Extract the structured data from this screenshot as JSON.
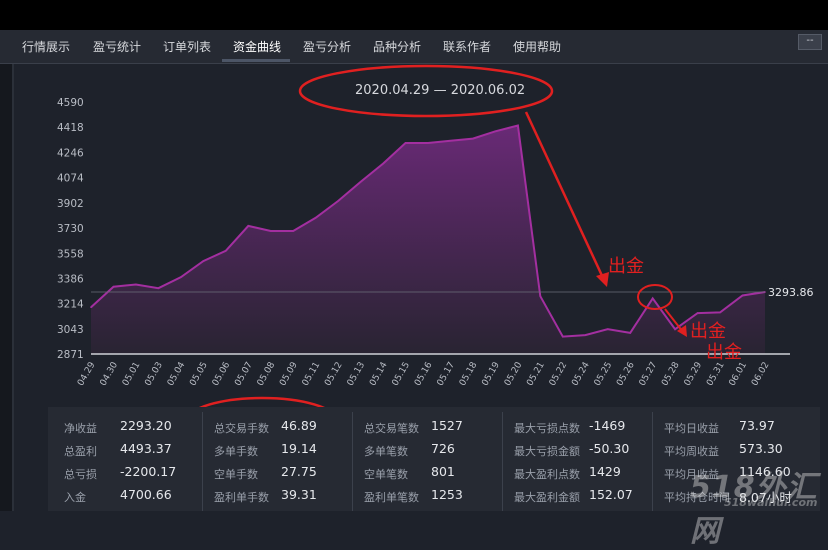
{
  "tabs": [
    {
      "label": "行情展示"
    },
    {
      "label": "盈亏统计"
    },
    {
      "label": "订单列表"
    },
    {
      "label": "资金曲线"
    },
    {
      "label": "盈亏分析"
    },
    {
      "label": "品种分析"
    },
    {
      "label": "联系作者"
    },
    {
      "label": "使用帮助"
    }
  ],
  "window": {
    "minimize_label": "--"
  },
  "chart_title": "2020.04.29 — 2020.06.02",
  "annotations": {
    "withdraw_1": "出金",
    "withdraw_2": "出金",
    "withdraw_3": "出金"
  },
  "colors": {
    "line": "#a32fa0",
    "fill_top": "#6d2a7a",
    "annotation": "#e02020"
  },
  "chart_data": {
    "type": "area",
    "x": [
      "04.29",
      "04.30",
      "05.01",
      "05.03",
      "05.04",
      "05.05",
      "05.06",
      "05.07",
      "05.08",
      "05.09",
      "05.11",
      "05.12",
      "05.13",
      "05.14",
      "05.15",
      "05.16",
      "05.17",
      "05.18",
      "05.19",
      "05.20",
      "05.21",
      "05.22",
      "05.24",
      "05.25",
      "05.26",
      "05.27",
      "05.28",
      "05.29",
      "05.31",
      "06.01",
      "06.02"
    ],
    "y": [
      3190,
      3330,
      3345,
      3320,
      3395,
      3505,
      3575,
      3745,
      3710,
      3710,
      3800,
      3915,
      4045,
      4170,
      4310,
      4310,
      4325,
      4340,
      4390,
      4430,
      3265,
      2990,
      3000,
      3040,
      3015,
      3250,
      3040,
      3150,
      3155,
      3270,
      3293.86
    ],
    "yticks": [
      2871,
      3043,
      3214,
      3386,
      3558,
      3730,
      3902,
      4074,
      4246,
      4418,
      4590
    ],
    "ylim": [
      2871,
      4590
    ],
    "last_value_label": "3293.86",
    "grid": false
  },
  "stats": [
    [
      {
        "label": "净收益",
        "value": "2293.20"
      },
      {
        "label": "总盈利",
        "value": "4493.37"
      },
      {
        "label": "总亏损",
        "value": "-2200.17"
      },
      {
        "label": "入金",
        "value": "4700.66"
      }
    ],
    [
      {
        "label": "总交易手数",
        "value": "46.89"
      },
      {
        "label": "多单手数",
        "value": "19.14"
      },
      {
        "label": "空单手数",
        "value": "27.75"
      },
      {
        "label": "盈利单手数",
        "value": "39.31"
      }
    ],
    [
      {
        "label": "总交易笔数",
        "value": "1527"
      },
      {
        "label": "多单笔数",
        "value": "726"
      },
      {
        "label": "空单笔数",
        "value": "801"
      },
      {
        "label": "盈利单笔数",
        "value": "1253"
      }
    ],
    [
      {
        "label": "最大亏损点数",
        "value": "-1469"
      },
      {
        "label": "最大亏损金额",
        "value": "-50.30"
      },
      {
        "label": "最大盈利点数",
        "value": "1429"
      },
      {
        "label": "最大盈利金额",
        "value": "152.07"
      }
    ],
    [
      {
        "label": "平均日收益",
        "value": "73.97"
      },
      {
        "label": "平均周收益",
        "value": "573.30"
      },
      {
        "label": "平均月收益",
        "value": "1146.60"
      },
      {
        "label": "平均持仓时间",
        "value": "8.07小时"
      }
    ]
  ],
  "watermark": {
    "main": "518外汇网",
    "sub": "518waihui.com"
  }
}
